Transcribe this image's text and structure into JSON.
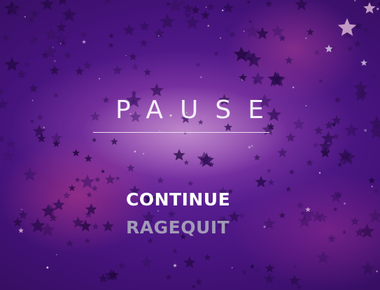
{
  "pause_menu": {
    "title": "PAUSE",
    "items": [
      {
        "label": "CONTINUE",
        "state": "selected"
      },
      {
        "label": "RAGEQUIT",
        "state": "unselected"
      }
    ]
  },
  "colors": {
    "title": "#f4eef8",
    "selected_item": "#ffffff",
    "unselected_item": "#a29ab8",
    "background_base": "#4c1586",
    "background_glow": "#f078dc",
    "star": "#2a0b4a"
  },
  "background": {
    "icon": "star-field",
    "theme": "purple-galaxy"
  }
}
